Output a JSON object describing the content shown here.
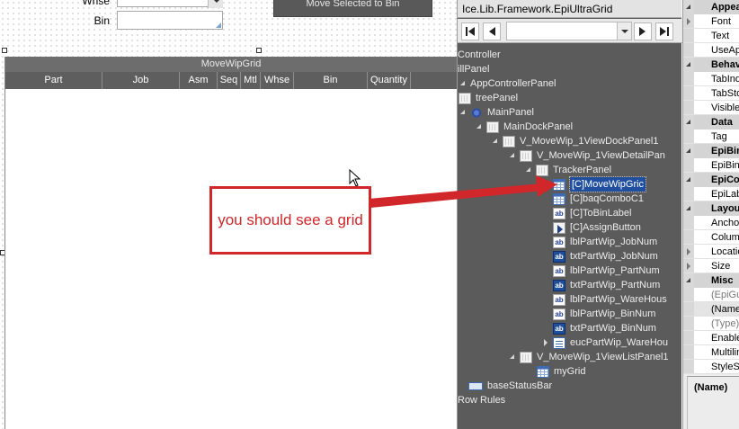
{
  "designer": {
    "whse_label": "Whse",
    "bin_label": "Bin",
    "whse_value": "",
    "bin_value": "",
    "move_button_label": "Move Selected to Bin",
    "grid": {
      "caption": "MoveWipGrid",
      "columns": [
        "Part",
        "Job",
        "Asm",
        "Seq",
        "Mtl",
        "Whse",
        "Bin",
        "Quantity"
      ]
    }
  },
  "tree": {
    "title": "Ice.Lib.Framework.EpiUltraGrid",
    "navigation_value": "",
    "nodes": [
      {
        "label": "Controller",
        "icon": "none",
        "expander": ""
      },
      {
        "label": "illPanel",
        "icon": "none",
        "expander": ""
      },
      {
        "label": "AppControllerPanel",
        "icon": "none",
        "expander": ""
      },
      {
        "label": "treePanel",
        "icon": "panel-icon",
        "expander": ""
      },
      {
        "label": "MainPanel",
        "icon": "gear-icon",
        "expander": ""
      },
      {
        "label": "MainDockPanel",
        "icon": "panel-icon",
        "expander": ""
      },
      {
        "label": "V_MoveWip_1ViewDockPanel1",
        "icon": "panel-icon",
        "expander": ""
      },
      {
        "label": "V_MoveWip_1ViewDetailPan",
        "icon": "panel-icon",
        "expander": ""
      },
      {
        "label": "TrackerPanel",
        "icon": "panel-icon",
        "expander": ""
      },
      {
        "label": "[C]MoveWipGric",
        "icon": "grid-icon",
        "expander": ""
      },
      {
        "label": "[C]baqComboC1",
        "icon": "combo-icon",
        "expander": ""
      },
      {
        "label": "[C]ToBinLabel",
        "icon": "label-icon",
        "expander": ""
      },
      {
        "label": "[C]AssignButton",
        "icon": "button-icon",
        "expander": ""
      },
      {
        "label": "lblPartWip_JobNum",
        "icon": "label-icon",
        "expander": ""
      },
      {
        "label": "txtPartWip_JobNum",
        "icon": "textbox-icon",
        "expander": ""
      },
      {
        "label": "lblPartWip_PartNum",
        "icon": "label-icon",
        "expander": ""
      },
      {
        "label": "txtPartWip_PartNum",
        "icon": "textbox-icon",
        "expander": ""
      },
      {
        "label": "lblPartWip_WareHous",
        "icon": "label-icon",
        "expander": ""
      },
      {
        "label": "lblPartWip_BinNum",
        "icon": "label-icon",
        "expander": ""
      },
      {
        "label": "txtPartWip_BinNum",
        "icon": "textbox-icon",
        "expander": ""
      },
      {
        "label": "eucPartWip_WareHou",
        "icon": "euc-combo-icon",
        "expander": ""
      },
      {
        "label": "V_MoveWip_1ViewListPanel1",
        "icon": "panel-icon",
        "expander": ""
      },
      {
        "label": "myGrid",
        "icon": "grid-icon",
        "expander": ""
      },
      {
        "label": "baseStatusBar",
        "icon": "statusbar-icon",
        "expander": ""
      },
      {
        "label": "Row Rules",
        "icon": "none",
        "expander": ""
      }
    ]
  },
  "properties": {
    "rows": [
      {
        "label": "Appea",
        "kind": "category"
      },
      {
        "label": "Font",
        "kind": "item-expand"
      },
      {
        "label": "Text",
        "kind": "item"
      },
      {
        "label": "UseAp",
        "kind": "item"
      },
      {
        "label": "Behav",
        "kind": "category"
      },
      {
        "label": "TabInd",
        "kind": "item"
      },
      {
        "label": "TabSto",
        "kind": "item"
      },
      {
        "label": "Visible",
        "kind": "item"
      },
      {
        "label": "Data",
        "kind": "category"
      },
      {
        "label": "Tag",
        "kind": "item"
      },
      {
        "label": "EpiBin",
        "kind": "category"
      },
      {
        "label": "EpiBin",
        "kind": "item"
      },
      {
        "label": "EpiCo",
        "kind": "category"
      },
      {
        "label": "EpiLab",
        "kind": "item"
      },
      {
        "label": "Layou",
        "kind": "category"
      },
      {
        "label": "Ancho",
        "kind": "item"
      },
      {
        "label": "Colum",
        "kind": "item"
      },
      {
        "label": "Locatio",
        "kind": "item-expand"
      },
      {
        "label": "Size",
        "kind": "item-expand"
      },
      {
        "label": "Misc",
        "kind": "category"
      },
      {
        "label": "(EpiGu",
        "kind": "item-grey"
      },
      {
        "label": "(Name",
        "kind": "item"
      },
      {
        "label": "(Type)",
        "kind": "item-grey"
      },
      {
        "label": "Enable",
        "kind": "item"
      },
      {
        "label": "Multilin",
        "kind": "item"
      },
      {
        "label": "StyleSe",
        "kind": "item"
      }
    ],
    "description_title": "(Name)"
  },
  "annotation": {
    "callout_text": "you should see a grid",
    "color": "#d1262a"
  }
}
